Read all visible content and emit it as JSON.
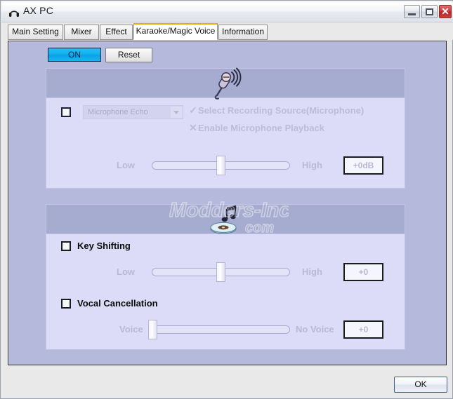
{
  "window": {
    "title": "AX PC",
    "icon": "headphones-icon",
    "buttons": {
      "minimize": "minimize-icon",
      "maximize": "maximize-icon",
      "close": "✕"
    }
  },
  "tabs": [
    {
      "label": "Main Setting",
      "active": false
    },
    {
      "label": "Mixer",
      "active": false
    },
    {
      "label": "Effect",
      "active": false
    },
    {
      "label": "Karaoke/Magic Voice",
      "active": true
    },
    {
      "label": "Information",
      "active": false
    }
  ],
  "toolbar": {
    "on_label": "ON",
    "reset_label": "Reset"
  },
  "microphone_section": {
    "header_icon": "microphone-icon",
    "checkbox_checked": false,
    "combo": {
      "value": "Microphone Echo",
      "arrow": "chevron-down-icon"
    },
    "status": [
      {
        "mark": "✓",
        "text": "Select Recording Source(Microphone)"
      },
      {
        "mark": "✕",
        "text": "Enable Microphone Playback"
      }
    ],
    "slider": {
      "min_label": "Low",
      "max_label": "High",
      "value_display": "+0dB",
      "position_percent": 50
    }
  },
  "music_section": {
    "header_icon": "cd-music-note-icon",
    "key_shifting": {
      "label": "Key Shifting",
      "checked": false,
      "slider": {
        "min_label": "Low",
        "max_label": "High",
        "value_display": "+0",
        "position_percent": 50
      }
    },
    "vocal_cancellation": {
      "label": "Vocal Cancellation",
      "checked": false,
      "slider": {
        "min_label": "Voice",
        "max_label": "No Voice",
        "value_display": "+0",
        "position_percent": 0
      }
    }
  },
  "watermark": {
    "line1": "Modders-Inc",
    "line2": "com"
  },
  "footer": {
    "ok_label": "OK"
  },
  "colors": {
    "panel_bg": "#b5b9dc",
    "card_bg": "#dcdcf8",
    "card_header_bg": "#a6accf",
    "accent_on": "#12b2ee",
    "active_tab_border": "#f0a511",
    "close_button": "#cf3c3c"
  }
}
